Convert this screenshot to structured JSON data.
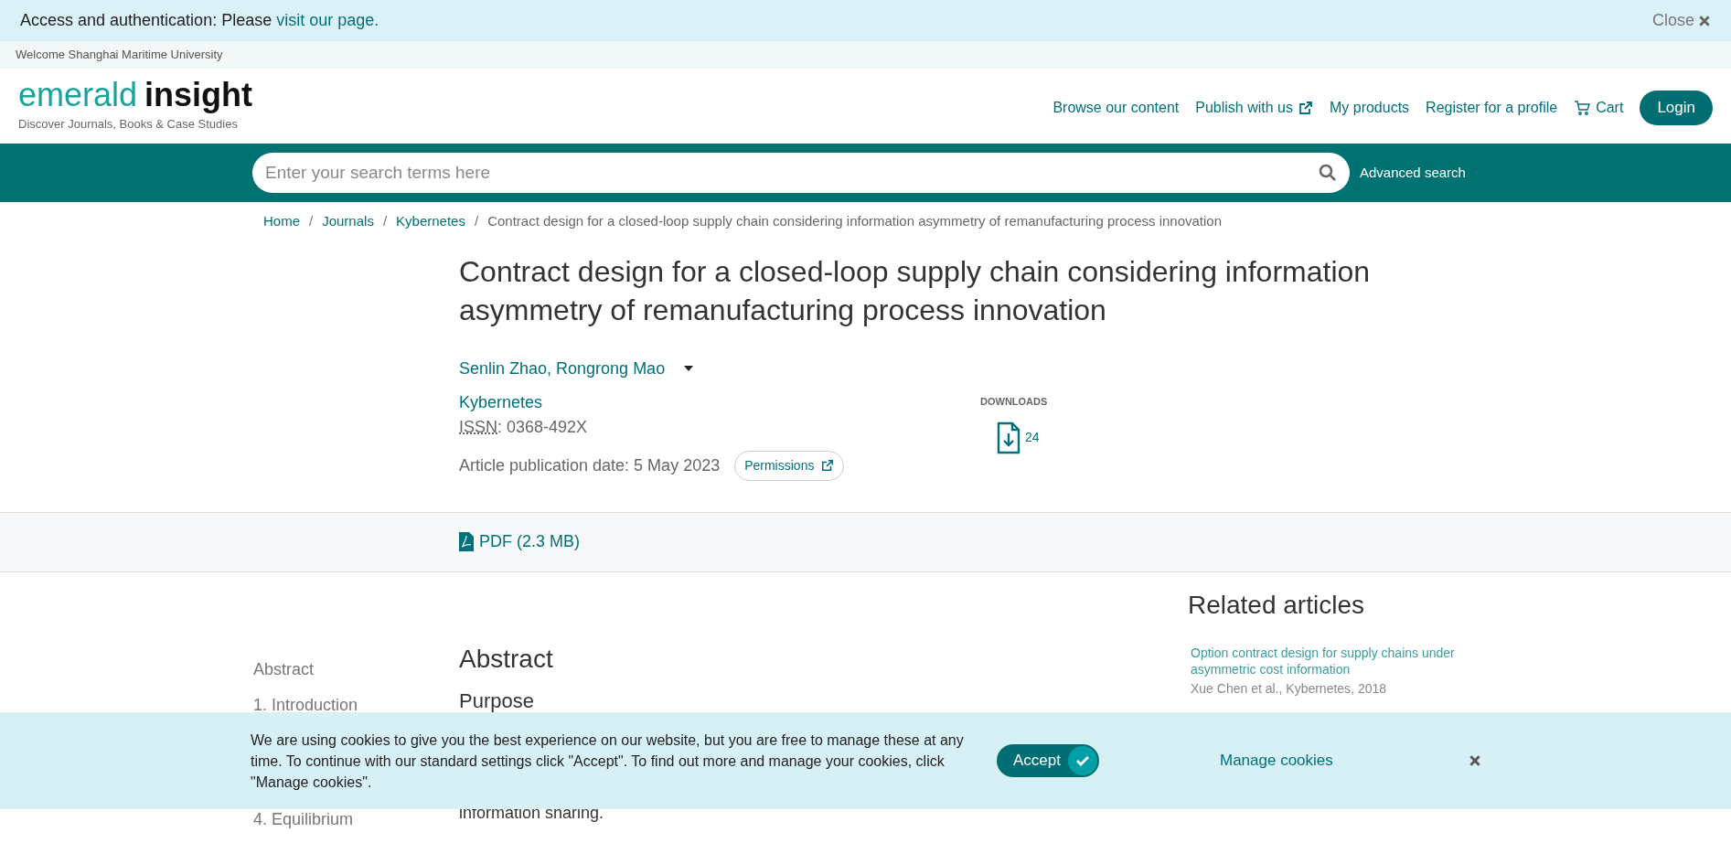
{
  "access_banner": {
    "text": "Access and authentication: Please",
    "link": "visit our page.",
    "close": "Close"
  },
  "welcome": "Welcome Shanghai Maritime University",
  "logo": {
    "word1": "emerald",
    "word2": "insight",
    "tagline": "Discover Journals, Books & Case Studies"
  },
  "nav": [
    {
      "label": "Browse our content",
      "kind": "link"
    },
    {
      "label": "Publish with us",
      "kind": "external"
    },
    {
      "label": "My products",
      "kind": "link"
    },
    {
      "label": "Register for a profile",
      "kind": "link"
    },
    {
      "label": "Cart",
      "kind": "cart"
    }
  ],
  "login": "Login",
  "search": {
    "placeholder": "Enter your search terms here",
    "advanced": "Advanced search"
  },
  "breadcrumb_separator": "/",
  "breadcrumbs": [
    {
      "label": "Home",
      "link": true
    },
    {
      "label": "Journals",
      "link": true
    },
    {
      "label": "Kybernetes",
      "link": true
    },
    {
      "label": "Contract design for a closed-loop supply chain considering information asymmetry of remanufacturing process innovation",
      "link": false
    }
  ],
  "article": {
    "title": "Contract design for a closed-loop supply chain considering information asymmetry of remanufacturing process innovation",
    "authors": "Senlin Zhao, Rongrong Mao",
    "journal": "Kybernetes",
    "issn_label": "ISSN",
    "issn": ": 0368-492X",
    "date": "Article publication date: 5 May 2023",
    "permissions": "Permissions",
    "downloads_label": "DOWNLOADS",
    "downloads": "24"
  },
  "pdf": "PDF (2.3 MB)",
  "toc": [
    "Abstract",
    "1. Introduction",
    "4. Equilibrium"
  ],
  "abstract": {
    "heading": "Abstract",
    "subheading": "Purpose",
    "text": "information sharing."
  },
  "related": {
    "heading": "Related articles",
    "items": [
      {
        "title": "Option contract design for supply chains under asymmetric cost information",
        "meta": "Xue Chen et al., Kybernetes, 2018"
      }
    ]
  },
  "cookies": {
    "text": "We are using cookies to give you the best experience on our website, but you are free to manage these at any time. To continue with our standard settings click \"Accept\". To find out more and manage your cookies, click \"Manage cookies\".",
    "accept": "Accept",
    "manage": "Manage cookies"
  }
}
